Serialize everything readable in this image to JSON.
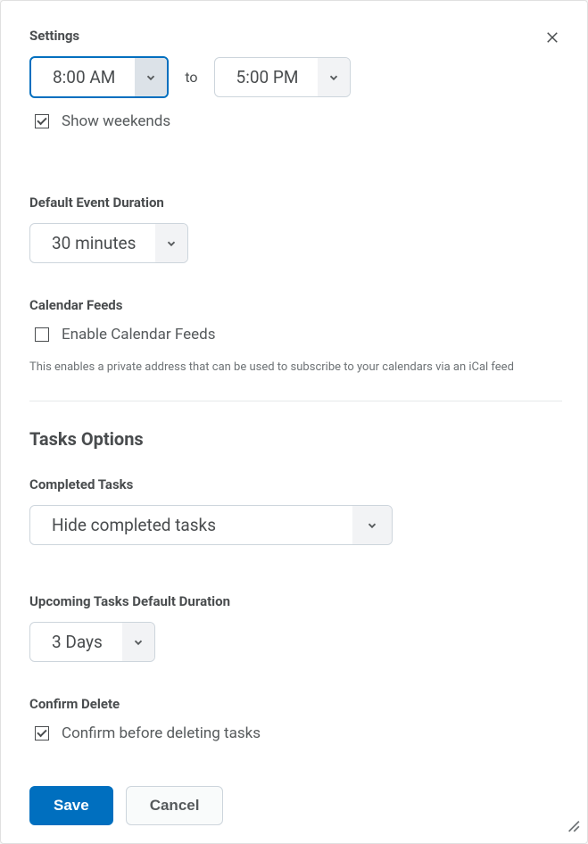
{
  "header": {
    "settings_label": "Settings"
  },
  "times": {
    "start_value": "8:00 AM",
    "to_label": "to",
    "end_value": "5:00 PM"
  },
  "show_weekends": {
    "checked": true,
    "label": "Show weekends"
  },
  "default_duration": {
    "label": "Default Event Duration",
    "value": "30 minutes"
  },
  "calendar_feeds": {
    "label": "Calendar Feeds",
    "checkbox_label": "Enable Calendar Feeds",
    "checked": false,
    "help": "This enables a private address that can be used to subscribe to your calendars via an iCal feed"
  },
  "tasks": {
    "heading": "Tasks Options",
    "completed_label": "Completed Tasks",
    "completed_value": "Hide completed tasks",
    "upcoming_label": "Upcoming Tasks Default Duration",
    "upcoming_value": "3 Days",
    "confirm_delete_label": "Confirm Delete",
    "confirm_delete_checkbox_label": "Confirm before deleting tasks",
    "confirm_delete_checked": true
  },
  "footer": {
    "save_label": "Save",
    "cancel_label": "Cancel"
  }
}
